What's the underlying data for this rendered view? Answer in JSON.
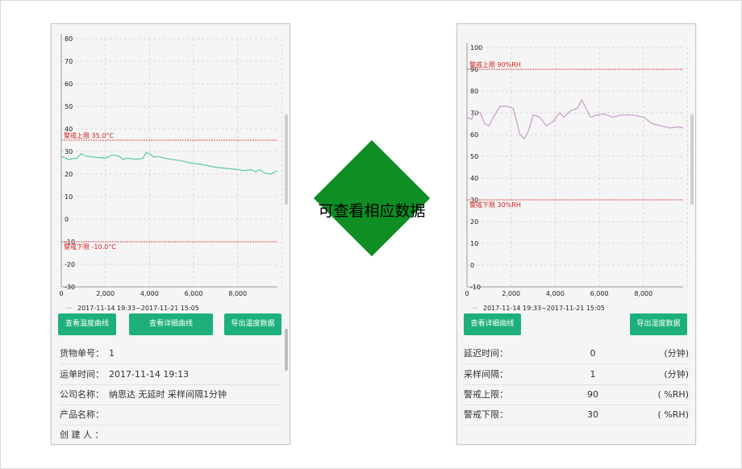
{
  "center_label": "可查看相应数据",
  "left_phone": {
    "chart": {
      "x_ticks": [
        "0",
        "2,000",
        "4,000",
        "6,000",
        "8,000"
      ],
      "y_ticks": [
        "80",
        "70",
        "60",
        "50",
        "40",
        "30",
        "20",
        "10",
        "0",
        "-10",
        "-20",
        "-30"
      ],
      "upper_limit_label": "警戒上限 35.0°C",
      "lower_limit_label": "警戒下限 -10.0°C",
      "legend_label": "2017-11-14 19:33~2017-11-21 15:05",
      "line_color": "#5cc8a0"
    },
    "buttons": {
      "temp_curve": "查看温度曲线",
      "detail_curve": "查看详细曲线",
      "export": "导出温度数据"
    },
    "info": [
      {
        "label": "货物单号：",
        "value": "1"
      },
      {
        "label": "运单时间：",
        "value": "2017-11-14  19:13"
      },
      {
        "label": "公司名称：",
        "value": "纳思达 无延时 采样间隔1分钟"
      },
      {
        "label": "产品名称：",
        "value": ""
      },
      {
        "label": "创 建 人 ：",
        "value": ""
      }
    ]
  },
  "right_phone": {
    "chart": {
      "x_ticks": [
        "0",
        "2,000",
        "4,000",
        "6,000",
        "8,000"
      ],
      "y_ticks": [
        "100",
        "90",
        "80",
        "70",
        "60",
        "50",
        "40",
        "30",
        "20",
        "10",
        "0",
        "-10"
      ],
      "upper_limit_label": "警戒上限 90%RH",
      "lower_limit_label": "警戒下限 30%RH",
      "legend_label": "2017-11-14 19:33~2017-11-21 15:05",
      "line_color": "#c79ac8"
    },
    "buttons": {
      "detail_curve": "查看详细曲线",
      "export": "导出湿度数据"
    },
    "params": [
      {
        "label": "延迟时间：",
        "value": "0",
        "unit": "(分钟)"
      },
      {
        "label": "采样间隔：",
        "value": "1",
        "unit": "(分钟)"
      },
      {
        "label": "警戒上限：",
        "value": "90",
        "unit": "( %RH)"
      },
      {
        "label": "警戒下限：",
        "value": "30",
        "unit": "( %RH)"
      }
    ]
  },
  "chart_data": [
    {
      "type": "line",
      "title": "",
      "xlabel": "",
      "ylabel": "",
      "xlim": [
        0,
        9800
      ],
      "ylim": [
        -30,
        80
      ],
      "x_tick_values": [
        0,
        2000,
        4000,
        6000,
        8000
      ],
      "y_tick_values": [
        80,
        70,
        60,
        50,
        40,
        30,
        20,
        10,
        0,
        -10,
        -20,
        -30
      ],
      "grid": true,
      "legend": "bottom-left",
      "thresholds": [
        {
          "label": "警戒上限 35.0°C",
          "value": 35
        },
        {
          "label": "警戒下限 -10.0°C",
          "value": -10
        }
      ],
      "series": [
        {
          "name": "2017-11-14 19:33~2017-11-21 15:05",
          "x": [
            0,
            300,
            700,
            900,
            1100,
            1500,
            2000,
            2300,
            2600,
            2800,
            3000,
            3400,
            3700,
            3850,
            4000,
            4200,
            4400,
            4700,
            5000,
            5400,
            5800,
            6200,
            6600,
            7000,
            7500,
            8000,
            8300,
            8600,
            8800,
            9000,
            9200,
            9500,
            9800
          ],
          "y": [
            28,
            26.5,
            27,
            29,
            28,
            27.5,
            27,
            28.5,
            28,
            26.5,
            27,
            26.5,
            27,
            29.5,
            29,
            27.5,
            27.8,
            27,
            26.5,
            26,
            25,
            24.5,
            23.8,
            23,
            22.5,
            22,
            21.5,
            22,
            21,
            22,
            20.5,
            20,
            21.5
          ]
        }
      ]
    },
    {
      "type": "line",
      "title": "",
      "xlabel": "",
      "ylabel": "",
      "xlim": [
        0,
        9800
      ],
      "ylim": [
        -10,
        100
      ],
      "x_tick_values": [
        0,
        2000,
        4000,
        6000,
        8000
      ],
      "y_tick_values": [
        100,
        90,
        80,
        70,
        60,
        50,
        40,
        30,
        20,
        10,
        0,
        -10
      ],
      "grid": true,
      "legend": "bottom-left",
      "thresholds": [
        {
          "label": "警戒上限 90%RH",
          "value": 90
        },
        {
          "label": "警戒下限 30%RH",
          "value": 30
        }
      ],
      "series": [
        {
          "name": "2017-11-14 19:33~2017-11-21 15:05",
          "x": [
            0,
            200,
            400,
            600,
            800,
            1000,
            1200,
            1500,
            1800,
            2100,
            2400,
            2600,
            2800,
            3000,
            3300,
            3600,
            3900,
            4200,
            4400,
            4700,
            5000,
            5200,
            5400,
            5600,
            5900,
            6200,
            6600,
            7000,
            7500,
            8000,
            8400,
            8800,
            9200,
            9600,
            9800
          ],
          "y": [
            68,
            67,
            71,
            70,
            65,
            64,
            68,
            73,
            73,
            72,
            60,
            58,
            62,
            69,
            68,
            64,
            66,
            70,
            68,
            71,
            72,
            76,
            72,
            68,
            69,
            69.5,
            68,
            69,
            69,
            68,
            65,
            64,
            63,
            63.5,
            63
          ]
        }
      ]
    }
  ]
}
